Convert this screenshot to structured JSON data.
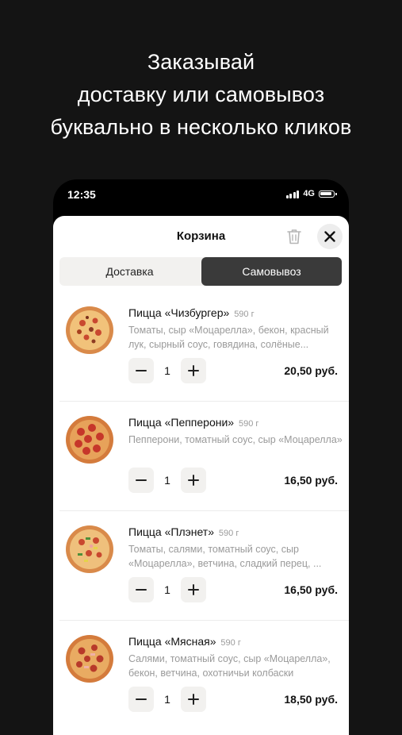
{
  "headline": {
    "line1": "Заказывай",
    "line2": "доставку или самовывоз",
    "line3": "буквально в несколько кликов"
  },
  "status_bar": {
    "time": "12:35",
    "network": "4G"
  },
  "cart": {
    "title": "Корзина",
    "tabs": [
      {
        "label": "Доставка",
        "selected": false
      },
      {
        "label": "Самовывоз",
        "selected": true
      }
    ],
    "items": [
      {
        "name": "Пицца «Чизбургер»",
        "weight": "590 г",
        "description": "Томаты, сыр «Моцарелла», бекон, красный лук, сырный соус, говядина, солёные...",
        "quantity": "1",
        "price": "20,50 руб."
      },
      {
        "name": "Пицца «Пепперони»",
        "weight": "590 г",
        "description": "Пепперони, томатный соус, сыр «Моцарелла»",
        "quantity": "1",
        "price": "16,50 руб."
      },
      {
        "name": "Пицца «Плэнет»",
        "weight": "590 г",
        "description": "Томаты, салями, томатный соус, сыр «Моцарелла», ветчина, сладкий перец, ...",
        "quantity": "1",
        "price": "16,50 руб."
      },
      {
        "name": "Пицца «Мясная»",
        "weight": "590 г",
        "description": "Салями, томатный соус, сыр «Моцарелла», бекон, ветчина, охотничьи колбаски",
        "quantity": "1",
        "price": "18,50 руб."
      }
    ]
  },
  "colors": {
    "background": "#141414",
    "sheet": "#ffffff",
    "selected_tab": "#3a3a3a",
    "muted_text": "#9a9a9a"
  },
  "icons": {
    "trash": "trash-icon",
    "close": "close-icon",
    "minus": "minus-icon",
    "plus": "plus-icon"
  }
}
